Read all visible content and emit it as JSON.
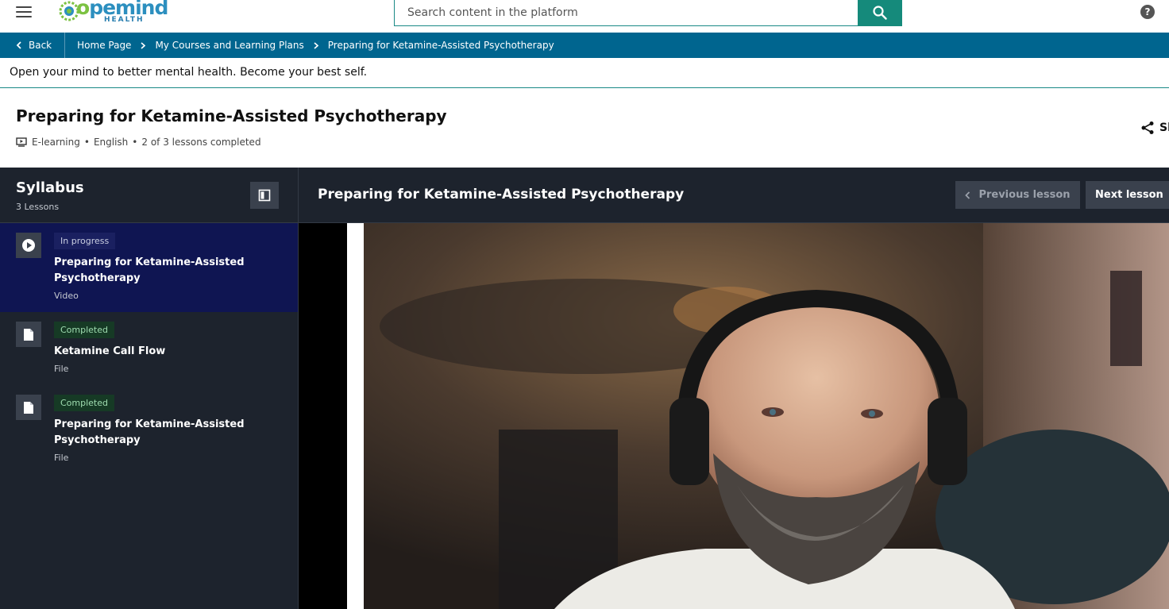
{
  "header": {
    "logo_text_pre": "",
    "logo_text_o": "o",
    "logo_text_post": "pemind",
    "logo_sub": "HEALTH",
    "search_placeholder": "Search content in the platform",
    "help_label": "?"
  },
  "breadcrumb": {
    "back_label": "Back",
    "items": [
      "Home Page",
      "My Courses and Learning Plans",
      "Preparing for Ketamine-Assisted Psychotherapy"
    ]
  },
  "tagline": "Open your mind to better mental health. Become your best self.",
  "course": {
    "title": "Preparing for Ketamine-Assisted Psychotherapy",
    "type": "E-learning",
    "language": "English",
    "progress": "2 of 3 lessons completed",
    "share_label": "Sh"
  },
  "syllabus": {
    "title": "Syllabus",
    "count": "3 Lessons",
    "lessons": [
      {
        "status": "In progress",
        "name": "Preparing for Ketamine-Assisted Psychotherapy",
        "type": "Video",
        "icon": "play-icon"
      },
      {
        "status": "Completed",
        "name": "Ketamine Call Flow",
        "type": "File",
        "icon": "file-icon"
      },
      {
        "status": "Completed",
        "name": "Preparing for Ketamine-Assisted Psychotherapy",
        "type": "File",
        "icon": "file-icon"
      }
    ]
  },
  "player": {
    "title": "Preparing for Ketamine-Assisted Psychotherapy",
    "prev_label": "Previous lesson",
    "next_label": "Next lesson"
  },
  "colors": {
    "brand_teal": "#158a7b",
    "crumb_blue": "#00658f",
    "panel_dark": "#1d232d",
    "active_lesson": "#0f1552"
  }
}
